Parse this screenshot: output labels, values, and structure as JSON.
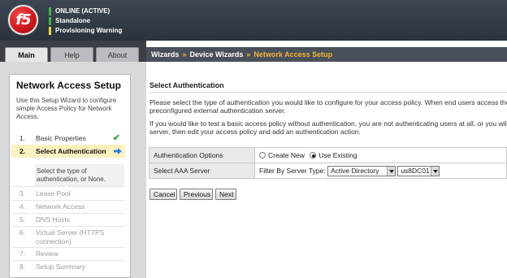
{
  "header": {
    "logo_text": "f5",
    "status": [
      "ONLINE (ACTIVE)",
      "Standalone",
      "Provisioning Warning"
    ]
  },
  "tabs": [
    {
      "label": "Main",
      "active": true
    },
    {
      "label": "Help",
      "active": false
    },
    {
      "label": "About",
      "active": false
    }
  ],
  "breadcrumb": {
    "items": [
      "Wizards",
      "Device Wizards"
    ],
    "separator": "»",
    "current": "Network Access Setup"
  },
  "wizard": {
    "title": "Network Access Setup",
    "intro": "Use this Setup Wizard to configure simple Access Policy for Network Access.",
    "steps": [
      {
        "num": "1.",
        "label": "Basic Properties",
        "state": "done"
      },
      {
        "num": "2.",
        "label": "Select Authentication",
        "state": "current"
      },
      {
        "num": "3.",
        "label": "Lease Pool",
        "state": "pending"
      },
      {
        "num": "4.",
        "label": "Network Access",
        "state": "pending"
      },
      {
        "num": "5.",
        "label": "DNS Hosts",
        "state": "pending"
      },
      {
        "num": "6.",
        "label": "Virtual Server (HTTPS connection)",
        "label_line1": "Virtual Server (HTTPS",
        "label_line2": "connection)",
        "state": "pending"
      },
      {
        "num": "7.",
        "label": "Review",
        "state": "pending"
      },
      {
        "num": "8.",
        "label": "Setup Summary",
        "state": "pending"
      }
    ],
    "current_step_description": "Select the type of authentication, or None."
  },
  "main": {
    "section_title": "Select Authentication",
    "paragraph1_line1": "Please select the type of authentication you would like to configure for your access policy. When end users access the",
    "paragraph1_line2": "preconfigured external authentication server.",
    "paragraph2_line1": "If you would like to test a basic access policy without authentication, you are not authenticating users at all, or you will",
    "paragraph2_line2": "server, then edit your access policy and add an authentication action.",
    "form": {
      "auth_options_label": "Authentication Options",
      "radio_create_new": "Create New",
      "radio_use_existing": "Use Existing",
      "selected_option": "Use Existing",
      "aaa_server_label": "Select AAA Server",
      "filter_label": "Filter By Server Type:",
      "server_type_value": "Active Directory",
      "server_value": "us8DC01"
    },
    "buttons": {
      "cancel": "Cancel",
      "previous": "Previous",
      "next": "Next"
    }
  },
  "colors": {
    "banner": "#2b323d",
    "status_ok": "#4caf50",
    "status_warn": "#e9d84a",
    "breadcrumb_current": "#f0b53a",
    "current_step_bg": "#fbf2c2",
    "logo_red": "#c8161b"
  },
  "icons": {
    "done_step": "check-icon",
    "current_step": "arrow-right-icon"
  }
}
